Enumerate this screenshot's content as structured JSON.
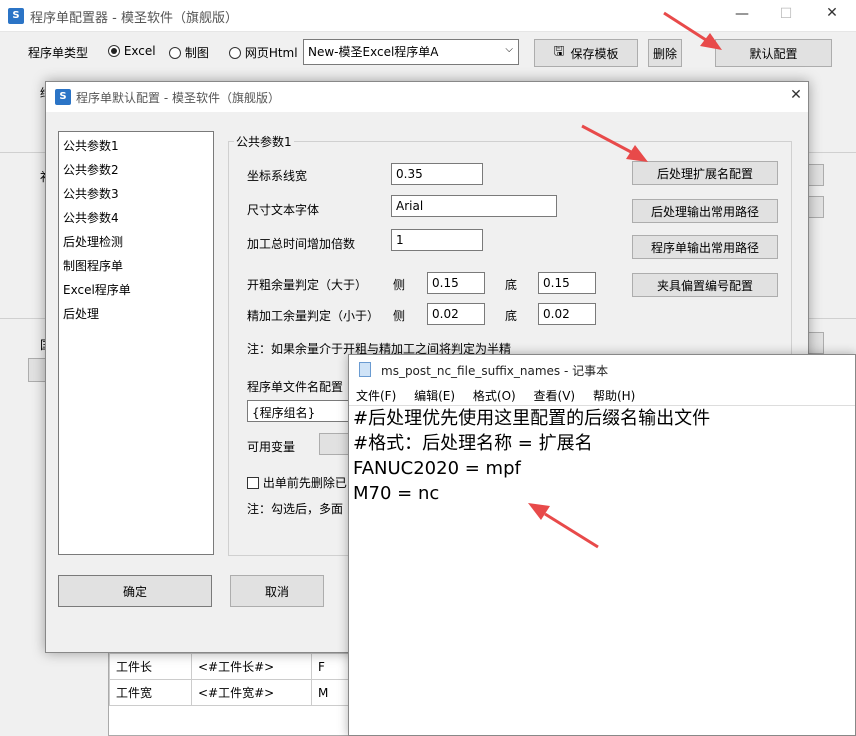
{
  "main_window": {
    "title": "程序单配置器 - 模圣软件（旗舰版）",
    "type_label": "程序单类型",
    "radios": [
      {
        "label": "Excel",
        "checked": true
      },
      {
        "label": "制图",
        "checked": false
      },
      {
        "label": "网页Html",
        "checked": false
      }
    ],
    "template_select": "New-模圣Excel程序单A",
    "save_template_label": "保存模板",
    "delete_label": "删除",
    "default_config_label": "默认配置",
    "partial_labels": [
      "缉",
      "补",
      "国"
    ],
    "table_rows": [
      {
        "c1": "工件长",
        "c2": "<#工件长#>",
        "c3": "F"
      },
      {
        "c1": "工件宽",
        "c2": "<#工件宽#>",
        "c3": "M"
      }
    ]
  },
  "dialog": {
    "title": "程序单默认配置 - 模圣软件（旗舰版）",
    "list_items": [
      "公共参数1",
      "公共参数2",
      "公共参数3",
      "公共参数4",
      "后处理检测",
      "制图程序单",
      "Excel程序单",
      "后处理"
    ],
    "group_title": "公共参数1",
    "fields": {
      "coord_width_label": "坐标系线宽",
      "coord_width_value": "0.35",
      "dim_font_label": "尺寸文本字体",
      "dim_font_value": "Arial",
      "time_mult_label": "加工总时间增加倍数",
      "time_mult_value": "1",
      "rough_label": "开粗余量判定（大于）",
      "rough_side_label": "侧",
      "rough_side_value": "0.15",
      "rough_bottom_label": "底",
      "rough_bottom_value": "0.15",
      "finish_label": "精加工余量判定（小于）",
      "finish_side_label": "侧",
      "finish_side_value": "0.02",
      "finish_bottom_label": "底",
      "finish_bottom_value": "0.02",
      "note": "注：如果余量介于开粗与精加工之间将判定为半精",
      "filename_label": "程序单文件名配置",
      "filename_value": "{程序组名}",
      "vars_label": "可用变量",
      "checkbox_label": "出单前先删除已",
      "note2": "注：勾选后，多面"
    },
    "side_buttons": [
      "后处理扩展名配置",
      "后处理输出常用路径",
      "程序单输出常用路径",
      "夹具偏置编号配置"
    ],
    "ok_label": "确定",
    "cancel_label": "取消"
  },
  "notepad": {
    "title": "ms_post_nc_file_suffix_names - 记事本",
    "menu": [
      "文件(F)",
      "编辑(E)",
      "格式(O)",
      "查看(V)",
      "帮助(H)"
    ],
    "lines": [
      "#后处理优先使用这里配置的后缀名输出文件",
      "#格式：后处理名称 = 扩展名",
      "",
      "FANUC2020 = mpf",
      "M70 = nc"
    ]
  },
  "colors": {
    "arrow": "#e84a4a",
    "accent": "#2b74c6"
  }
}
